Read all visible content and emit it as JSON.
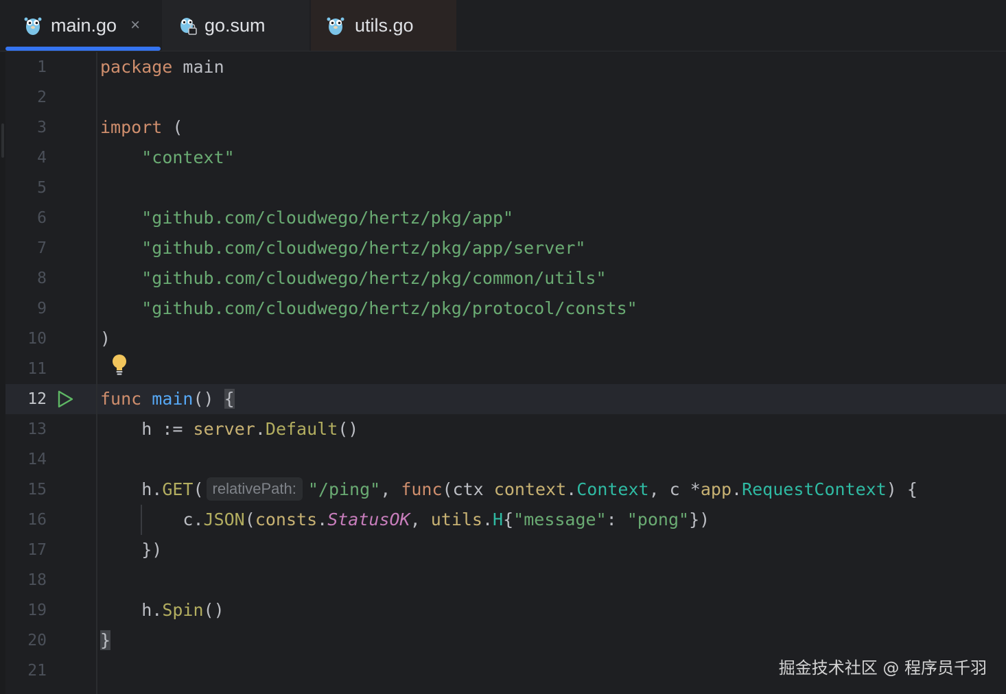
{
  "tabs": [
    {
      "label": "main.go",
      "icon": "gopher-icon",
      "active": true,
      "close": "×"
    },
    {
      "label": "go.sum",
      "icon": "gopher-lock-icon",
      "active": false
    },
    {
      "label": "utils.go",
      "icon": "gopher-icon",
      "active": false
    }
  ],
  "editor": {
    "current_line": 12,
    "line_numbers": [
      "1",
      "2",
      "3",
      "4",
      "5",
      "6",
      "7",
      "8",
      "9",
      "10",
      "11",
      "12",
      "13",
      "14",
      "15",
      "16",
      "17",
      "18",
      "19",
      "20",
      "21"
    ],
    "lines": {
      "l1": {
        "kw": "package",
        "name": "main"
      },
      "l3": {
        "kw": "import",
        "paren": "("
      },
      "l4": {
        "str": "\"context\""
      },
      "l6": {
        "str": "\"github.com/cloudwego/hertz/pkg/app\""
      },
      "l7": {
        "str": "\"github.com/cloudwego/hertz/pkg/app/server\""
      },
      "l8": {
        "str": "\"github.com/cloudwego/hertz/pkg/common/utils\""
      },
      "l9": {
        "str": "\"github.com/cloudwego/hertz/pkg/protocol/consts\""
      },
      "l10": {
        "paren": ")"
      },
      "l12": {
        "kw": "func",
        "fn": "main",
        "parens": "()",
        "brace": "{"
      },
      "l13": {
        "var": "h",
        "op": ":=",
        "pkg": "server",
        "dot": ".",
        "method": "Default",
        "parens": "()"
      },
      "l15": {
        "recv": "h.",
        "method": "GET",
        "open": "(",
        "hint": "relativePath:",
        "path": "\"/ping\"",
        "comma": ", ",
        "kw": "func",
        "params_open": "(ctx ",
        "ctx_pkg": "context",
        "ctx_type": "Context",
        "sep": ", c *",
        "app_pkg": "app",
        "app_type": "RequestContext",
        "tail": ") {"
      },
      "l16": {
        "recv": "c.",
        "method": "JSON",
        "open": "(",
        "consts_pkg": "consts",
        "dot": ".",
        "status": "StatusOK",
        "comma": ", ",
        "utils_pkg": "utils",
        "h_type": "H",
        "brace_open": "{",
        "key": "\"message\"",
        "colon": ": ",
        "val": "\"pong\"",
        "tail": "})"
      },
      "l17": {
        "text": "})"
      },
      "l19": {
        "recv": "h.",
        "method": "Spin",
        "parens": "()"
      },
      "l20": {
        "brace": "}"
      }
    }
  },
  "icons": {
    "run": "run-icon",
    "intention": "lightbulb-icon"
  },
  "colors": {
    "background": "#1e1f22",
    "keyword": "#cf8e6d",
    "string": "#6aab73",
    "function": "#56a8f5",
    "type": "#2fbaa3",
    "package": "#c8b273",
    "constant": "#c77dbb",
    "tab_accent": "#3574f0"
  },
  "watermark": "掘金技术社区 @ 程序员千羽"
}
